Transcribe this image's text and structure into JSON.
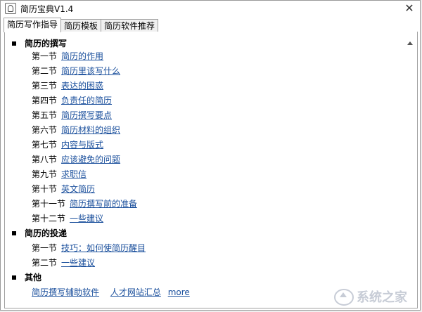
{
  "window": {
    "title": "简历宝典V1.4"
  },
  "tabs": [
    {
      "label": "简历写作指导",
      "active": true
    },
    {
      "label": "简历模板",
      "active": false
    },
    {
      "label": "简历软件推荐",
      "active": false
    }
  ],
  "sections": [
    {
      "heading": "简历的撰写",
      "items": [
        {
          "section": "第一节",
          "link": "简历的作用"
        },
        {
          "section": "第二节",
          "link": "简历里该写什么"
        },
        {
          "section": "第三节",
          "link": "表达的困惑"
        },
        {
          "section": "第四节",
          "link": "负责任的简历"
        },
        {
          "section": "第五节",
          "link": "简历撰写要点"
        },
        {
          "section": "第六节",
          "link": "简历材料的组织"
        },
        {
          "section": "第七节",
          "link": "内容与版式"
        },
        {
          "section": "第八节",
          "link": "应该避免的问题"
        },
        {
          "section": "第九节",
          "link": "求职信"
        },
        {
          "section": "第十节",
          "link": "英文简历"
        },
        {
          "section": "第十一节",
          "link": "简历撰写前的准备"
        },
        {
          "section": "第十二节",
          "link": "一些建议"
        }
      ]
    },
    {
      "heading": "简历的投递",
      "items": [
        {
          "section": "第一节",
          "link": "技巧：如何使简历醒目"
        },
        {
          "section": "第二节",
          "link": "一些建议"
        }
      ]
    },
    {
      "heading": "其他",
      "links": [
        "简历撰写辅助软件",
        "人才网站汇总",
        "more"
      ]
    }
  ],
  "watermark": {
    "text": "系统之家"
  },
  "colors": {
    "link": "#1a4f9c",
    "window_bg": "#ffffff",
    "chrome_bg": "#f0f0f0"
  }
}
